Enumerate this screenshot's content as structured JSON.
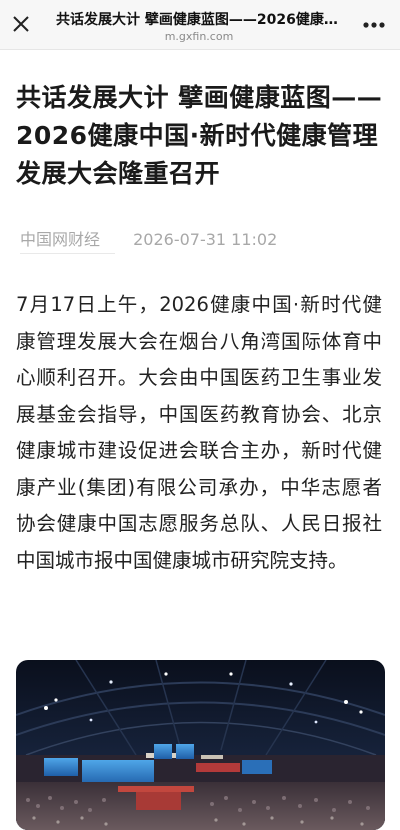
{
  "topbar": {
    "title": "共话发展大计 擘画健康蓝图——2026健康中国·新时代健康管理发展大会隆重召开",
    "domain": "m.gxfin.com",
    "close_icon": "close-icon",
    "more_icon": "more-icon"
  },
  "article": {
    "headline": "共话发展大计 擘画健康蓝图——2026健康中国·新时代健康管理发展大会隆重召开",
    "source": "中国网财经",
    "datetime": "2026-07-31 11:02",
    "paragraph": "7月17日上午，2026健康中国·新时代健康管理发展大会在烟台八角湾国际体育中心顺利召开。大会由中国医药卫生事业发展基金会指导，中国医药教育协会、北京健康城市建设促进会联合主办，新时代健康产业(集团)有限公司承办，中华志愿者协会健康中国志愿服务总队、人民日报社中国城市报中国健康城市研究院支持。"
  },
  "photo": {
    "subject": "arena-conference-photo"
  },
  "colors": {
    "topbar_bg": "#f7f7f7",
    "meta_text": "#a8a8a8",
    "body_text": "#222222"
  }
}
